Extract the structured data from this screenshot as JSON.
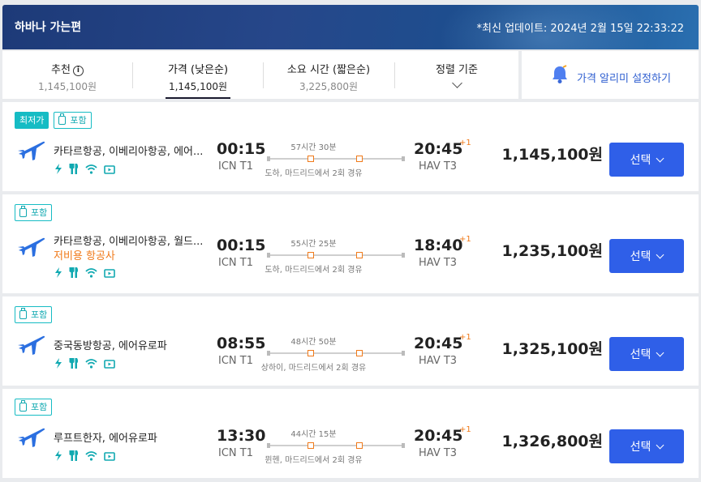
{
  "header": {
    "title": "하바나 가는편",
    "updated": "*최신 업데이트: 2024년 2월 15일 22:33:22"
  },
  "sort_tabs": [
    {
      "label": "추천",
      "value": "1,145,100원",
      "info_icon": "info-icon"
    },
    {
      "label": "가격 (낮은순)",
      "value": "1,145,100원"
    },
    {
      "label": "소요 시간 (짧은순)",
      "value": "3,225,800원"
    },
    {
      "label": "정렬 기준",
      "icon": "chevron-down-icon"
    }
  ],
  "alert": {
    "label": "가격 알리미 설정하기",
    "icon": "bell-icon"
  },
  "colors": {
    "accent": "#2f5fe8",
    "badge": "#16bcc4",
    "orange": "#f07a1a",
    "header": "#1d3a78"
  },
  "flights": [
    {
      "badges": {
        "cheapest": "최저가",
        "included": "포함"
      },
      "airline": "카타르항공, 이베리아항공, 에어...",
      "lcc": "",
      "dep_time": "00:15",
      "dep_airport": "ICN T1",
      "duration": "57시간 30분",
      "route": "도하, 마드리드에서 2회 경유",
      "arr_time": "20:45",
      "arr_plus": "+1",
      "arr_airport": "HAV T3",
      "price": "1,145,100원",
      "select": "선택"
    },
    {
      "badges": {
        "included": "포함"
      },
      "airline": "카타르항공, 이베리아항공, 월드...",
      "lcc": "저비용 항공사",
      "dep_time": "00:15",
      "dep_airport": "ICN T1",
      "duration": "55시간 25분",
      "route": "도하, 마드리드에서 2회 경유",
      "arr_time": "18:40",
      "arr_plus": "+1",
      "arr_airport": "HAV T3",
      "price": "1,235,100원",
      "select": "선택"
    },
    {
      "badges": {
        "included": "포함"
      },
      "airline": "중국동방항공, 에어유로파",
      "lcc": "",
      "dep_time": "08:55",
      "dep_airport": "ICN T1",
      "duration": "48시간 50분",
      "route": "상하이, 마드리드에서 2회 경유",
      "arr_time": "20:45",
      "arr_plus": "+1",
      "arr_airport": "HAV T3",
      "price": "1,325,100원",
      "select": "선택"
    },
    {
      "badges": {
        "included": "포함"
      },
      "airline": "루프트한자, 에어유로파",
      "lcc": "",
      "dep_time": "13:30",
      "dep_airport": "ICN T1",
      "duration": "44시간 15분",
      "route": "뮌헨, 마드리드에서 2회 경유",
      "arr_time": "20:45",
      "arr_plus": "+1",
      "arr_airport": "HAV T3",
      "price": "1,326,800원",
      "select": "선택"
    }
  ],
  "amenity_icons": [
    "power-icon",
    "meal-icon",
    "wifi-icon",
    "entertainment-icon"
  ]
}
